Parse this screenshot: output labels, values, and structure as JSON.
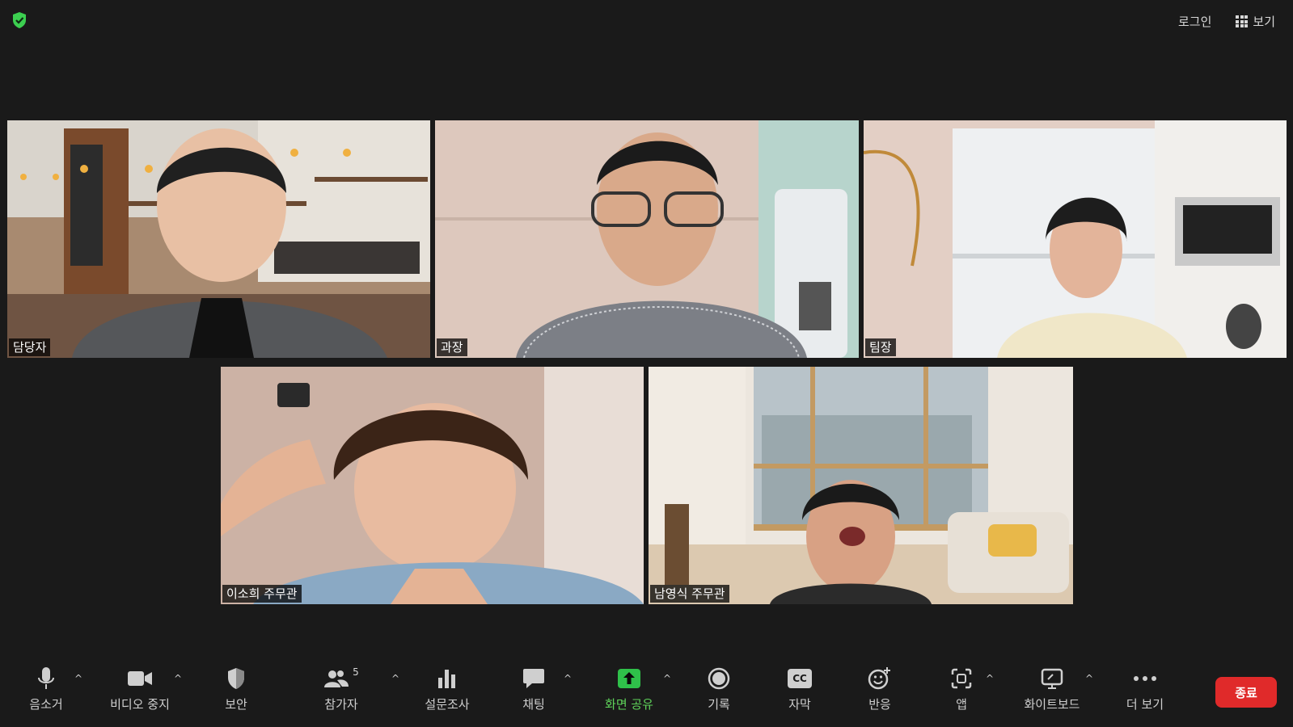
{
  "topbar": {
    "login": "로그인",
    "view": "보기"
  },
  "participants": [
    {
      "name": "담당자"
    },
    {
      "name": "과장"
    },
    {
      "name": "팀장"
    },
    {
      "name": "이소희 주무관"
    },
    {
      "name": "남영식 주무관",
      "active_speaker": true
    }
  ],
  "toolbar": {
    "mute": "음소거",
    "video": "비디오 중지",
    "security": "보안",
    "participants": "참가자",
    "participants_count": "5",
    "polls": "설문조사",
    "chat": "채팅",
    "share": "화면 공유",
    "record": "기록",
    "captions": "자막",
    "captions_icon_text": "CC",
    "reactions": "반응",
    "apps": "앱",
    "whiteboard": "화이트보드",
    "more": "더 보기",
    "end": "종료"
  },
  "colors": {
    "background": "#1a1a1a",
    "accent_green": "#44c94a",
    "end_red": "#e02a2a"
  }
}
